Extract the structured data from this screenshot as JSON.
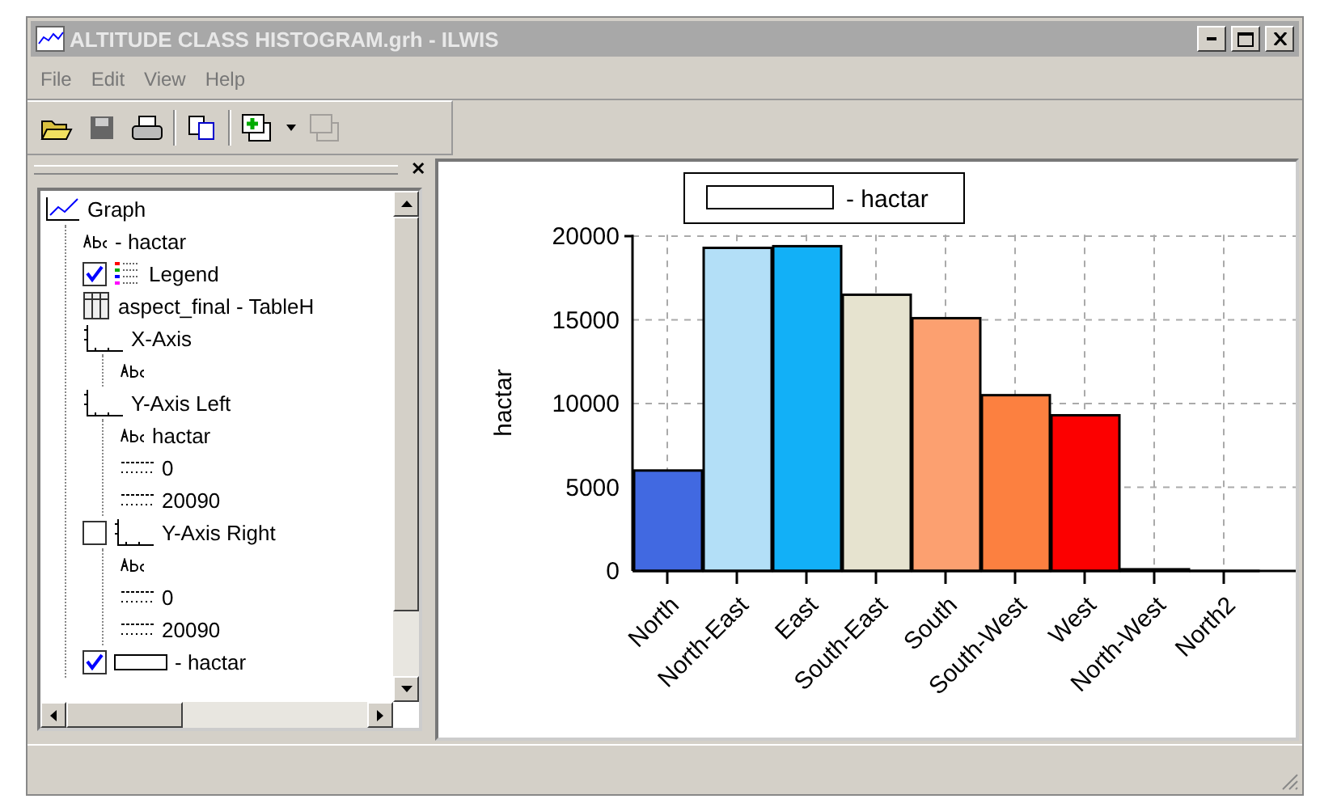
{
  "window": {
    "title": "ALTITUDE CLASS HISTOGRAM.grh - ILWIS"
  },
  "menu": [
    "File",
    "Edit",
    "View",
    "Help"
  ],
  "toolbar": [
    {
      "kind": "open",
      "disabled": false
    },
    {
      "kind": "save",
      "disabled": false
    },
    {
      "kind": "print",
      "disabled": false
    },
    {
      "kind": "sep"
    },
    {
      "kind": "copy",
      "disabled": false
    },
    {
      "kind": "sep"
    },
    {
      "kind": "add",
      "disabled": false
    },
    {
      "kind": "dropdown",
      "disabled": false
    },
    {
      "kind": "layers",
      "disabled": true
    }
  ],
  "side_pane": {
    "close": "✕"
  },
  "tree": [
    {
      "label": "Graph",
      "kind": "graph",
      "children": [
        {
          "label": "- hactar",
          "kind": "abc"
        },
        {
          "label": "Legend",
          "kind": "legend",
          "checked": true
        },
        {
          "label": "aspect_final - TableH",
          "kind": "table"
        },
        {
          "label": "X-Axis",
          "kind": "axis",
          "children": [
            {
              "kind": "abc"
            }
          ]
        },
        {
          "label": "Y-Axis Left",
          "kind": "axis",
          "children": [
            {
              "label": "hactar",
              "kind": "abc"
            },
            {
              "label": "0",
              "kind": "number"
            },
            {
              "label": "20090",
              "kind": "number"
            }
          ]
        },
        {
          "label": "Y-Axis Right",
          "kind": "axis",
          "checked": false,
          "children": [
            {
              "kind": "abc"
            },
            {
              "label": "0",
              "kind": "number"
            },
            {
              "label": "20090",
              "kind": "number"
            }
          ]
        },
        {
          "label": "- hactar",
          "kind": "series",
          "checked": true
        }
      ]
    }
  ],
  "chart": {
    "bars": [
      {
        "color": "#4169e1"
      },
      {
        "color": "#b3dff7"
      },
      {
        "color": "#12b0f7"
      },
      {
        "color": "#e6e3cf"
      },
      {
        "color": "#fca070"
      },
      {
        "color": "#fc8040"
      },
      {
        "color": "#fc0000"
      },
      {
        "color": "#000000"
      },
      {
        "color": "#000000"
      }
    ],
    "chart_data": {
      "type": "bar",
      "ylabel": "hactar",
      "grid": true,
      "categories": [
        "North",
        "North-East",
        "East",
        "South-East",
        "South",
        "South-West",
        "West",
        "North-West",
        "North2"
      ],
      "series": [
        {
          "name": "- hactar",
          "values": [
            6000,
            19300,
            19400,
            16500,
            15100,
            10500,
            9300,
            100,
            0
          ]
        }
      ],
      "ylim": [
        0,
        20090
      ],
      "yticks": [
        0,
        5000,
        10000,
        15000,
        20000
      ]
    }
  }
}
